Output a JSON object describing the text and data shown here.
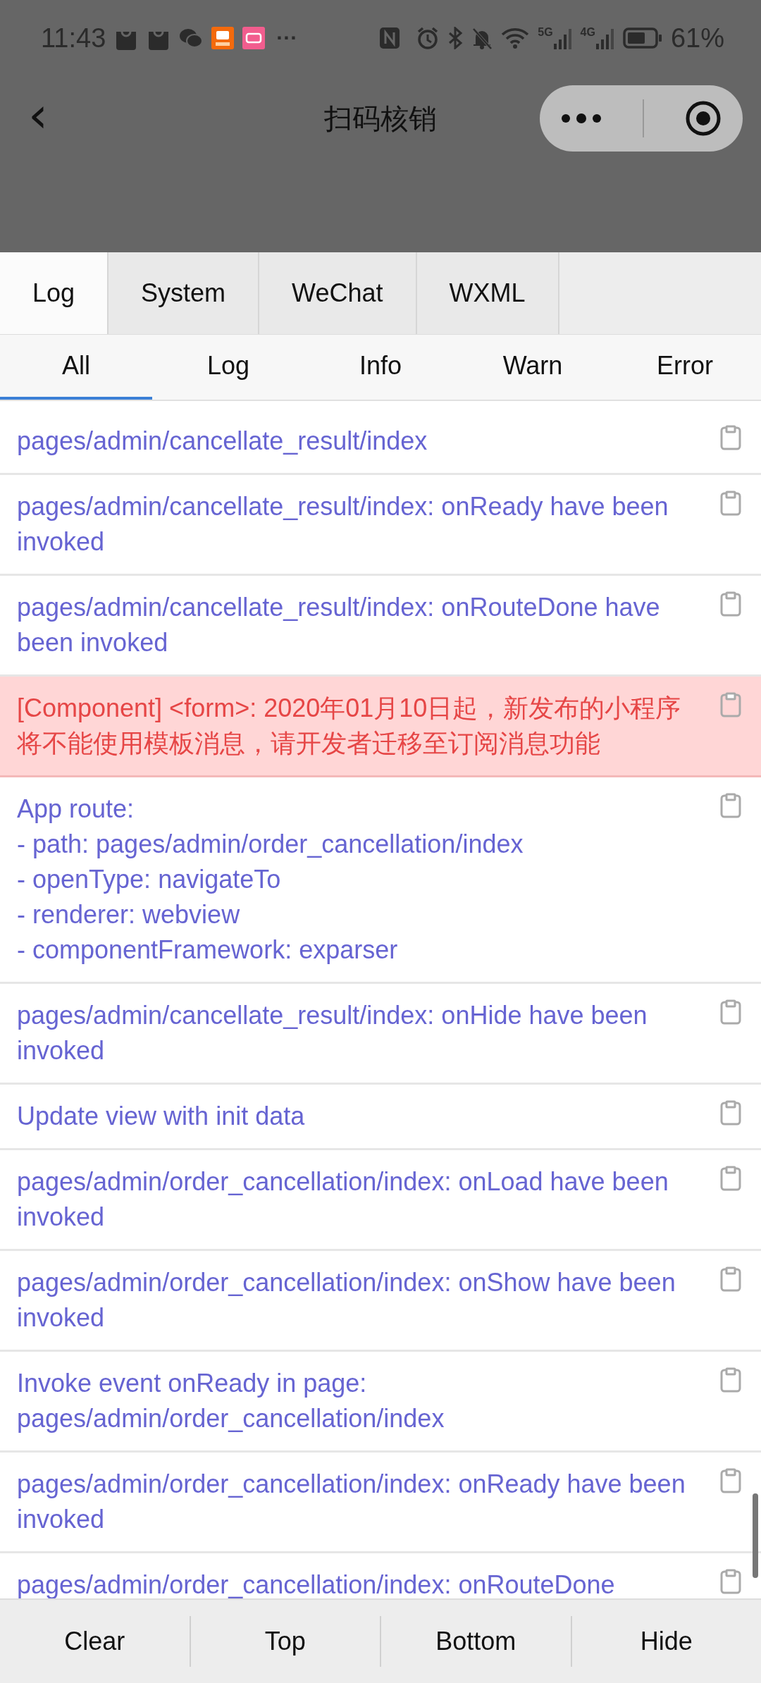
{
  "status_bar": {
    "time": "11:43",
    "more": "···",
    "network_1": "5G",
    "network_2": "4G",
    "battery": "61%"
  },
  "nav_bar": {
    "back": "‹",
    "title": "扫码核销"
  },
  "tabs": [
    {
      "label": "Log",
      "selected": true
    },
    {
      "label": "System",
      "selected": false
    },
    {
      "label": "WeChat",
      "selected": false
    },
    {
      "label": "WXML",
      "selected": false
    }
  ],
  "filters": [
    {
      "label": "All",
      "selected": true
    },
    {
      "label": "Log",
      "selected": false
    },
    {
      "label": "Info",
      "selected": false
    },
    {
      "label": "Warn",
      "selected": false
    },
    {
      "label": "Error",
      "selected": false
    }
  ],
  "logs": [
    {
      "kind": "log",
      "text": "pages/admin/cancellate_result/index"
    },
    {
      "kind": "log",
      "text": "pages/admin/cancellate_result/index: onReady have been invoked"
    },
    {
      "kind": "log",
      "text": "pages/admin/cancellate_result/index: onRouteDone have been invoked"
    },
    {
      "kind": "warn",
      "text": "[Component] <form>: 2020年01月10日起，新发布的小程序将不能使用模板消息，请开发者迁移至订阅消息功能"
    },
    {
      "kind": "log",
      "text": "App route:\n- path: pages/admin/order_cancellation/index\n- openType: navigateTo\n- renderer: webview\n- componentFramework: exparser"
    },
    {
      "kind": "log",
      "text": "pages/admin/cancellate_result/index: onHide have been invoked"
    },
    {
      "kind": "log",
      "text": "Update view with init data"
    },
    {
      "kind": "log",
      "text": "pages/admin/order_cancellation/index: onLoad have been invoked"
    },
    {
      "kind": "log",
      "text": "pages/admin/order_cancellation/index: onShow have been invoked"
    },
    {
      "kind": "log",
      "text": "Invoke event onReady in page:\npages/admin/order_cancellation/index"
    },
    {
      "kind": "log",
      "text": "pages/admin/order_cancellation/index: onReady have been invoked"
    },
    {
      "kind": "log",
      "text": "pages/admin/order_cancellation/index: onRouteDone"
    }
  ],
  "actions": [
    "Clear",
    "Top",
    "Bottom",
    "Hide"
  ]
}
